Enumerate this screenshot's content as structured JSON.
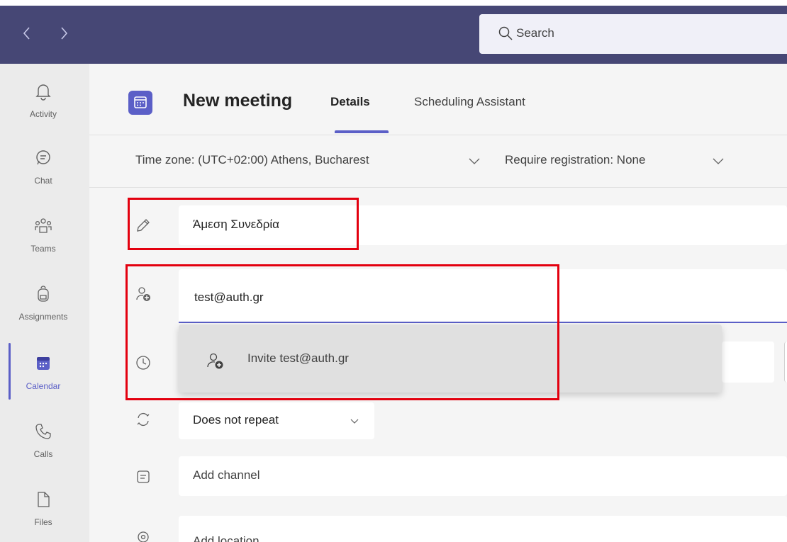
{
  "nav": {
    "back_icon": "chevron-left-icon",
    "forward_icon": "chevron-right-icon"
  },
  "search": {
    "placeholder": "Search",
    "icon": "search-icon"
  },
  "rail": {
    "items": [
      {
        "label": "Activity",
        "icon": "bell-icon"
      },
      {
        "label": "Chat",
        "icon": "chat-icon"
      },
      {
        "label": "Teams",
        "icon": "teams-icon"
      },
      {
        "label": "Assignments",
        "icon": "backpack-icon"
      },
      {
        "label": "Calendar",
        "icon": "calendar-icon",
        "active": true
      },
      {
        "label": "Calls",
        "icon": "phone-icon"
      },
      {
        "label": "Files",
        "icon": "file-icon"
      }
    ]
  },
  "header": {
    "title": "New meeting",
    "tabs": [
      {
        "label": "Details",
        "active": true
      },
      {
        "label": "Scheduling Assistant"
      }
    ]
  },
  "options": {
    "timezone": "Time zone: (UTC+02:00) Athens, Bucharest",
    "registration": "Require registration: None"
  },
  "form": {
    "title_value": "Άμεση Συνεδρία",
    "attendee_value": "test@auth.gr",
    "invite_suggestion": "Invite test@auth.gr",
    "repeat_value": "Does not repeat",
    "channel_placeholder": "Add channel",
    "location_placeholder": "Add location"
  },
  "colors": {
    "titlebar": "#464775",
    "accent": "#5b5fc7",
    "annotation": "#e3000f"
  }
}
